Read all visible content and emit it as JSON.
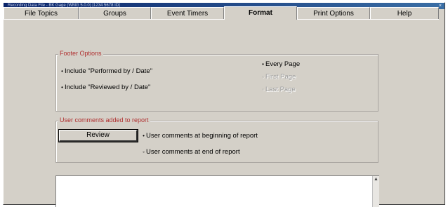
{
  "window": {
    "title": "Recording Data File - BK Gage (WMG 5.0.0) [1234 5678 ID]",
    "close_glyph": "×"
  },
  "tabs": [
    {
      "label": "File Topics"
    },
    {
      "label": "Groups"
    },
    {
      "label": "Event Timers"
    },
    {
      "label": "Format"
    },
    {
      "label": "Print Options"
    },
    {
      "label": "Help"
    }
  ],
  "active_tab": "Format",
  "footer_options": {
    "legend": "Footer Options",
    "include_performed": {
      "label": "Include \"Performed by / Date\"",
      "checked": true
    },
    "include_reviewed": {
      "label": "Include \"Reviewed by / Date\"",
      "checked": true
    },
    "every_page": {
      "label": "Every Page",
      "selected": true
    },
    "first_page": {
      "label": "First Page",
      "selected": false,
      "enabled": false
    },
    "last_page": {
      "label": "Last Page",
      "selected": false,
      "enabled": false
    }
  },
  "comments": {
    "legend": "User comments added to report",
    "review_button": "Review",
    "at_beginning": {
      "label": "User comments at beginning of report",
      "selected": true
    },
    "at_end": {
      "label": "User comments at end of report",
      "selected": false
    }
  },
  "comment_text": {
    "value": ""
  },
  "glyphs": {
    "selected": "•",
    "unselected": "◦",
    "scroll_up": "▲"
  },
  "colors": {
    "face": "#d4d0c8",
    "legend_text": "#b03030",
    "title_bar": "#0a246a"
  }
}
